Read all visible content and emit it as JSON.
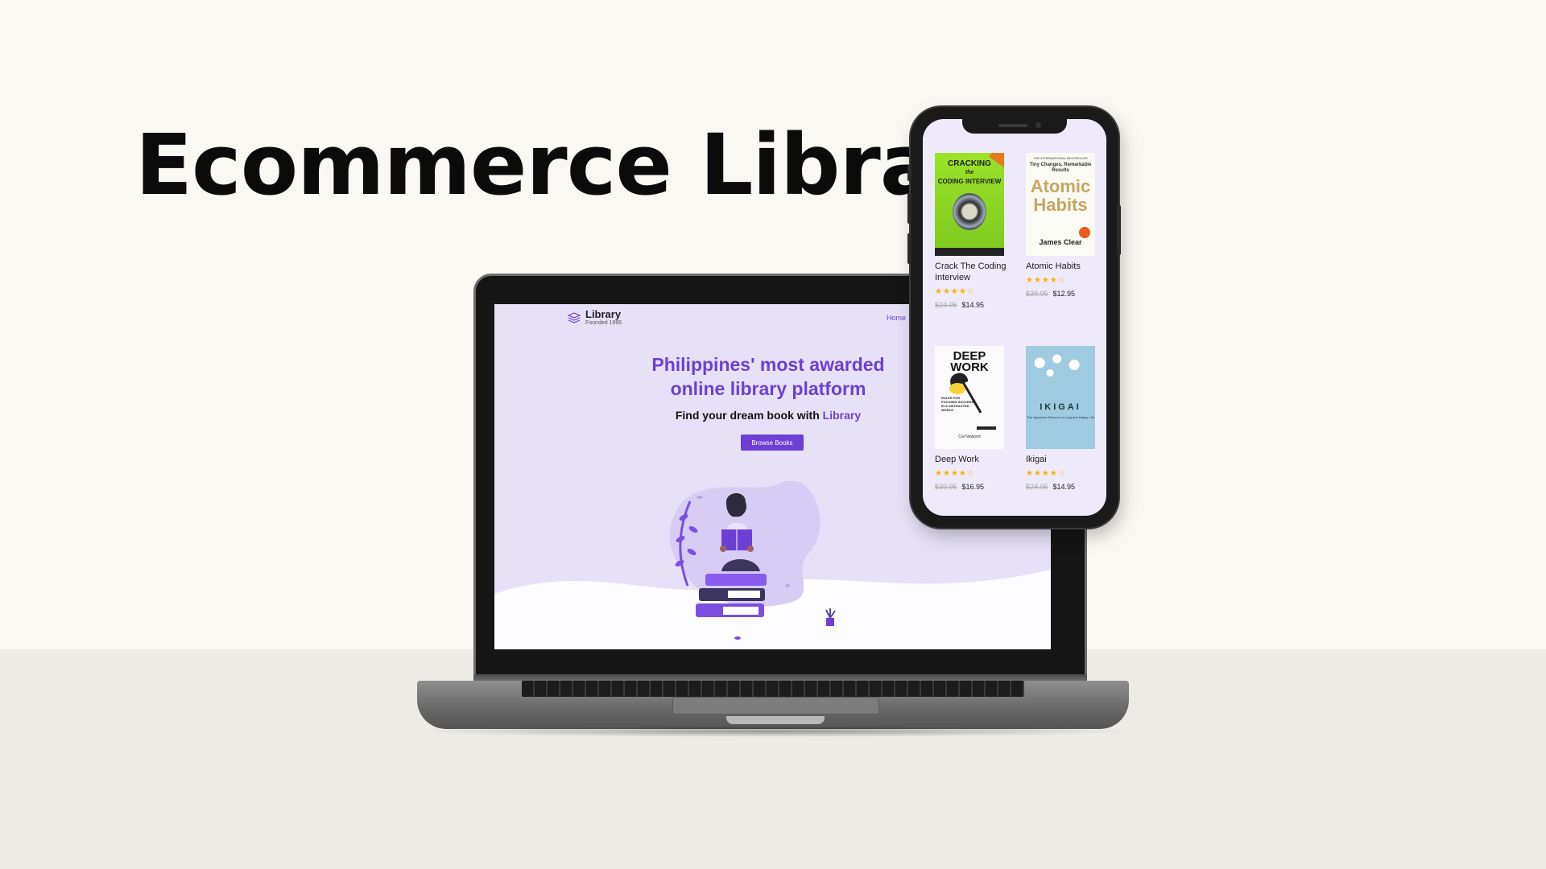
{
  "headline": "Ecommerce Library",
  "laptop": {
    "logo": {
      "name": "Library",
      "subtitle": "Founded 1995"
    },
    "nav": {
      "home": "Home"
    },
    "hero": {
      "title_line1": "Philippines' most awarded",
      "title_line2": "online library platform",
      "subtitle_prefix": "Find your dream book with ",
      "subtitle_accent": "Library",
      "button": "Browse Books"
    }
  },
  "phone": {
    "books": [
      {
        "title": "Crack The Coding Interview",
        "rating": 4.5,
        "stars": "★★★★☆",
        "old_price": "$24.95",
        "price": "$14.95",
        "cover": {
          "line1": "CRACKING",
          "line2": "the",
          "line3": "CODING INTERVIEW"
        }
      },
      {
        "title": "Atomic Habits",
        "rating": 4.5,
        "stars": "★★★★☆",
        "old_price": "$39.95",
        "price": "$12.95",
        "cover": {
          "line0": "THE INTERNATIONAL BESTSELLER",
          "line1": "Tiny Changes, Remarkable Results",
          "line2": "Atomic Habits",
          "line3": "James Clear"
        }
      },
      {
        "title": "Deep Work",
        "rating": 4.5,
        "stars": "★★★★☆",
        "old_price": "$39.95",
        "price": "$16.95",
        "cover": {
          "line1": "DEEP WORK",
          "line2": "RULES FOR FOCUSED SUCCESS IN A DISTRACTED WORLD",
          "line3": "Cal Newport"
        }
      },
      {
        "title": "Ikigai",
        "rating": 4.5,
        "stars": "★★★★☆",
        "old_price": "$24.95",
        "price": "$14.95",
        "cover": {
          "line1": "IKIGAI",
          "line2": "The Japanese Secret to a Long and Happy Life"
        }
      }
    ]
  },
  "colors": {
    "accent": "#6e3fd3",
    "screen_bg": "#e6e1f7",
    "star": "#f5b400",
    "page_bg": "#f9f8f3"
  }
}
